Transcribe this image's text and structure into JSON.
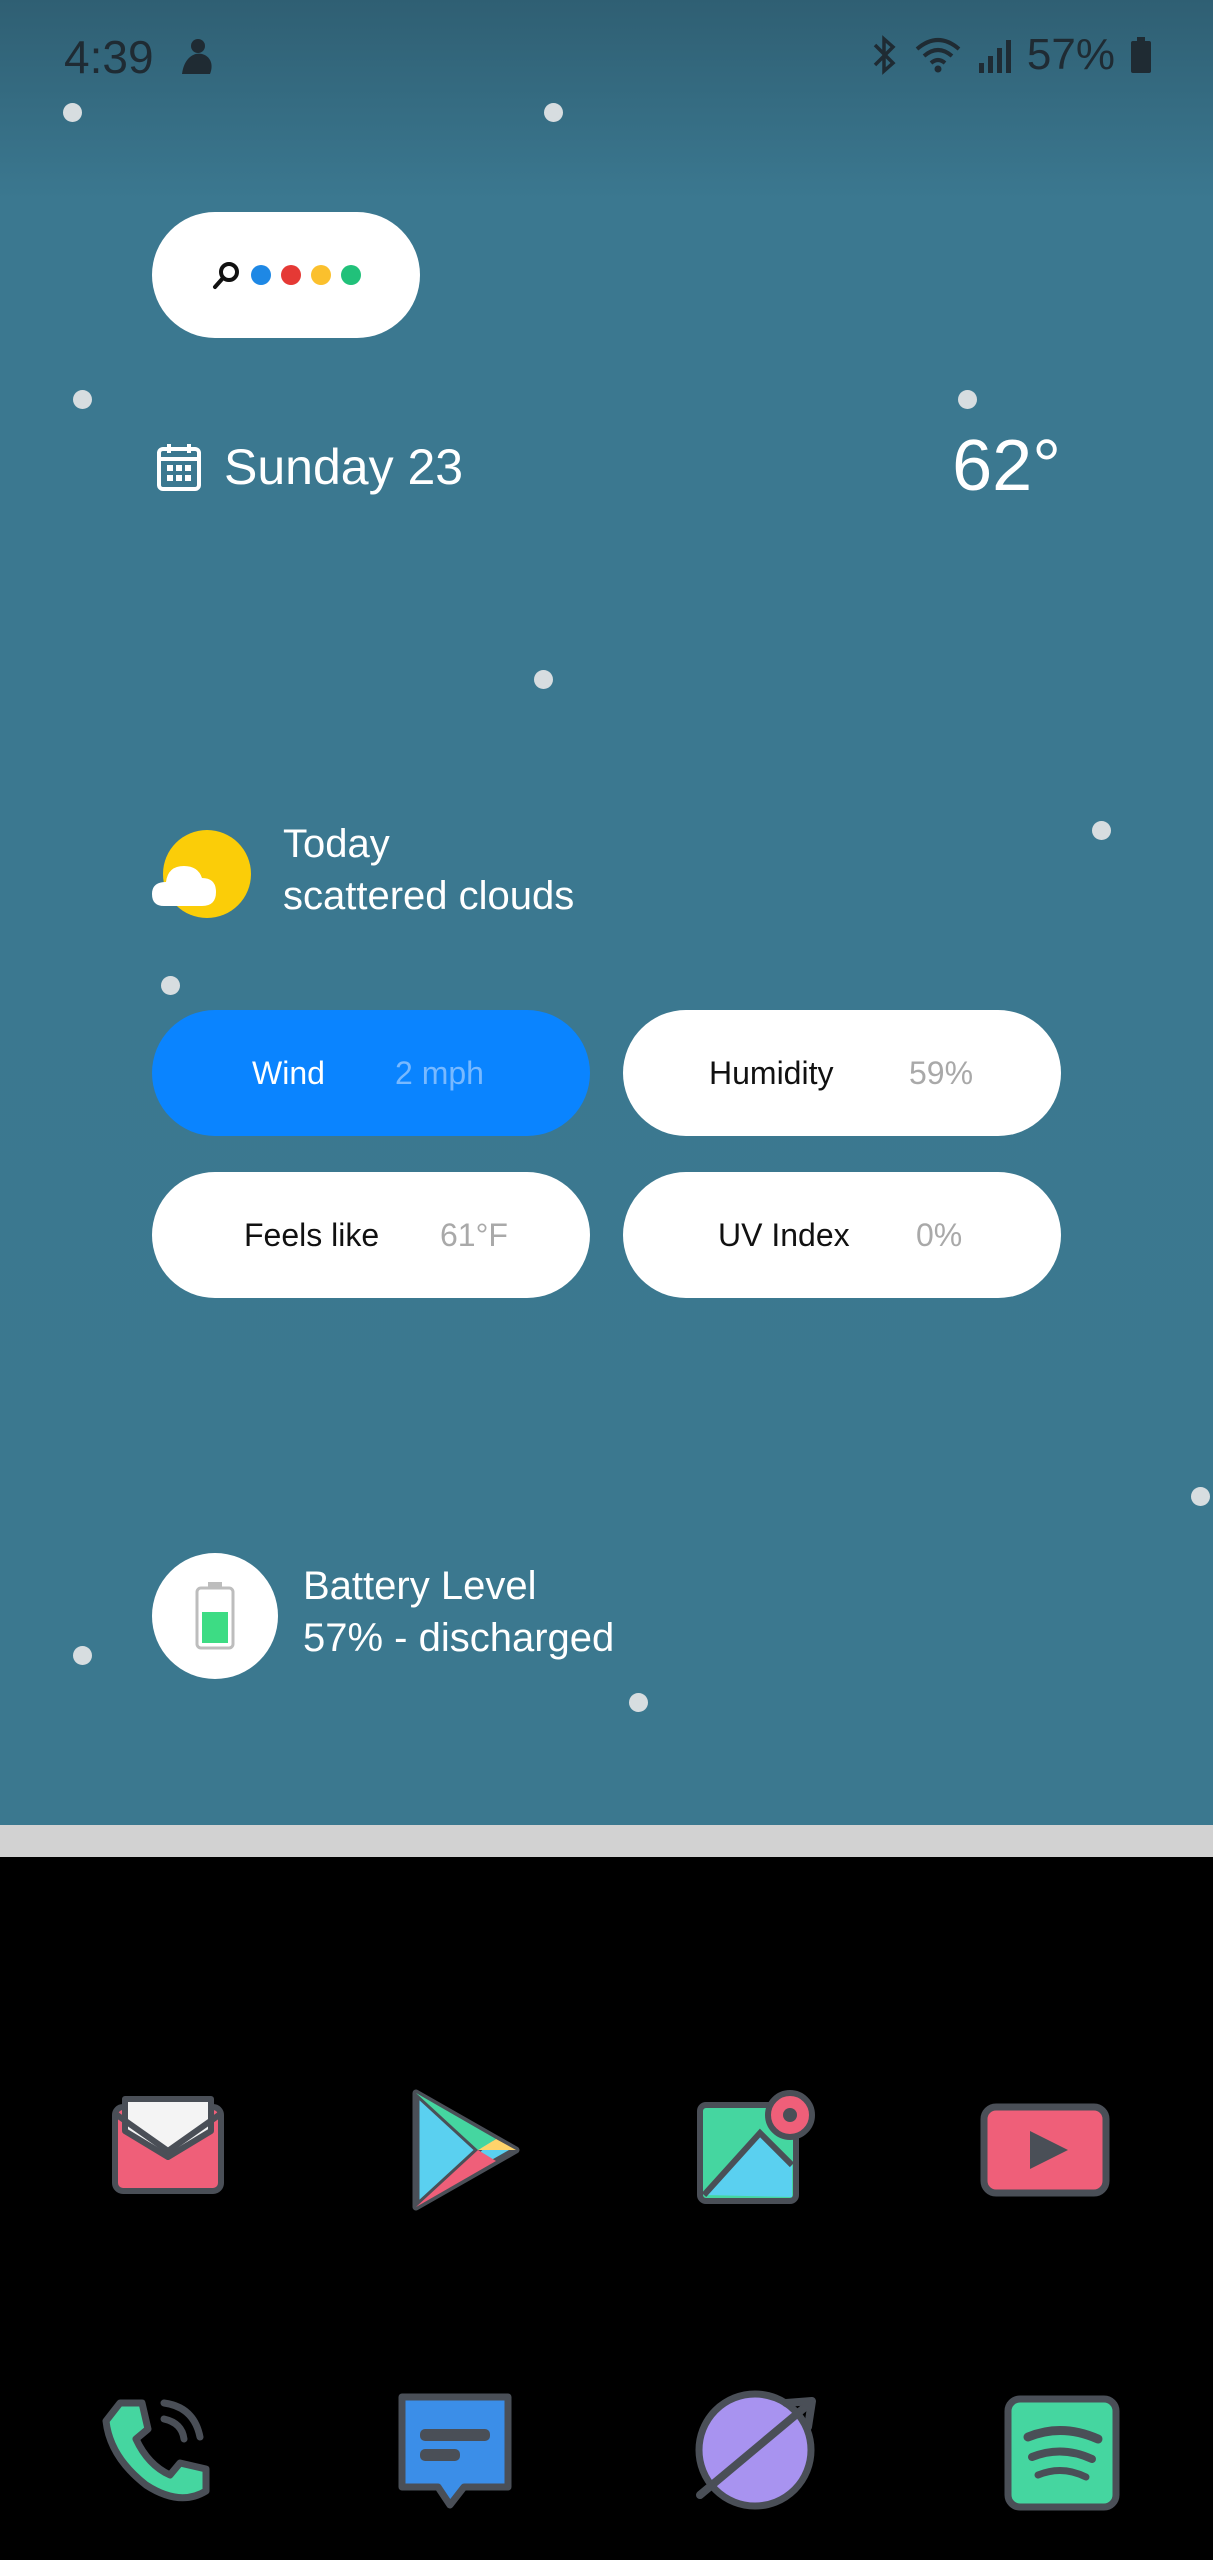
{
  "status_bar": {
    "time": "4:39",
    "battery_percent": "57%"
  },
  "search_widget": {
    "dot_colors": [
      "#1e88e5",
      "#e53935",
      "#fbc02d",
      "#21c17a"
    ]
  },
  "date": {
    "label": "Sunday 23"
  },
  "temperature": {
    "value": "62°"
  },
  "weather": {
    "title": "Today",
    "condition": "scattered clouds"
  },
  "stats": [
    {
      "label": "Wind",
      "value": "2 mph",
      "active": true
    },
    {
      "label": "Humidity",
      "value": "59%"
    },
    {
      "label": "Feels like",
      "value": "61°F"
    },
    {
      "label": "UV Index",
      "value": "0%"
    }
  ],
  "battery": {
    "title": "Battery Level",
    "detail": "57% - discharged",
    "level": 0.57
  },
  "dock": {
    "row1": [
      "mail-app-icon",
      "play-store-icon",
      "gallery-icon",
      "youtube-icon"
    ],
    "row2": [
      "phone-icon",
      "messages-icon",
      "browser-icon",
      "spotify-icon"
    ]
  },
  "colors": {
    "accent": "#0a84ff",
    "wallpaper": "#3b788f",
    "sun": "#fbcd08"
  }
}
